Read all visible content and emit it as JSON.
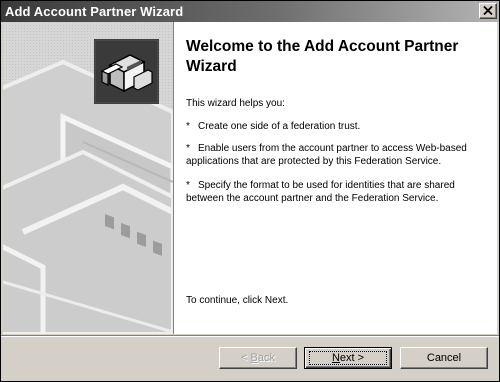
{
  "window": {
    "title": "Add Account Partner Wizard"
  },
  "icons": {
    "close": "close-icon",
    "wizard": "wizard-icon"
  },
  "main": {
    "heading": "Welcome to the Add Account Partner Wizard",
    "intro": "This wizard helps you:",
    "bullet_marker": "*",
    "bullets": [
      {
        "lines": [
          "Create one side of a federation trust."
        ]
      },
      {
        "lines": [
          "Enable users from the account partner to access Web-based",
          "applications that are protected by this Federation Service."
        ]
      },
      {
        "lines": [
          "Specify the format to be used for identities that are shared",
          "between the account partner and the Federation Service."
        ]
      }
    ],
    "continue_text": "To continue, click Next."
  },
  "buttons": {
    "back_mnemonic": "B",
    "back_rest": "ack",
    "back_prefix": "< ",
    "next_mnemonic": "N",
    "next_rest": "ext >",
    "cancel": "Cancel"
  }
}
